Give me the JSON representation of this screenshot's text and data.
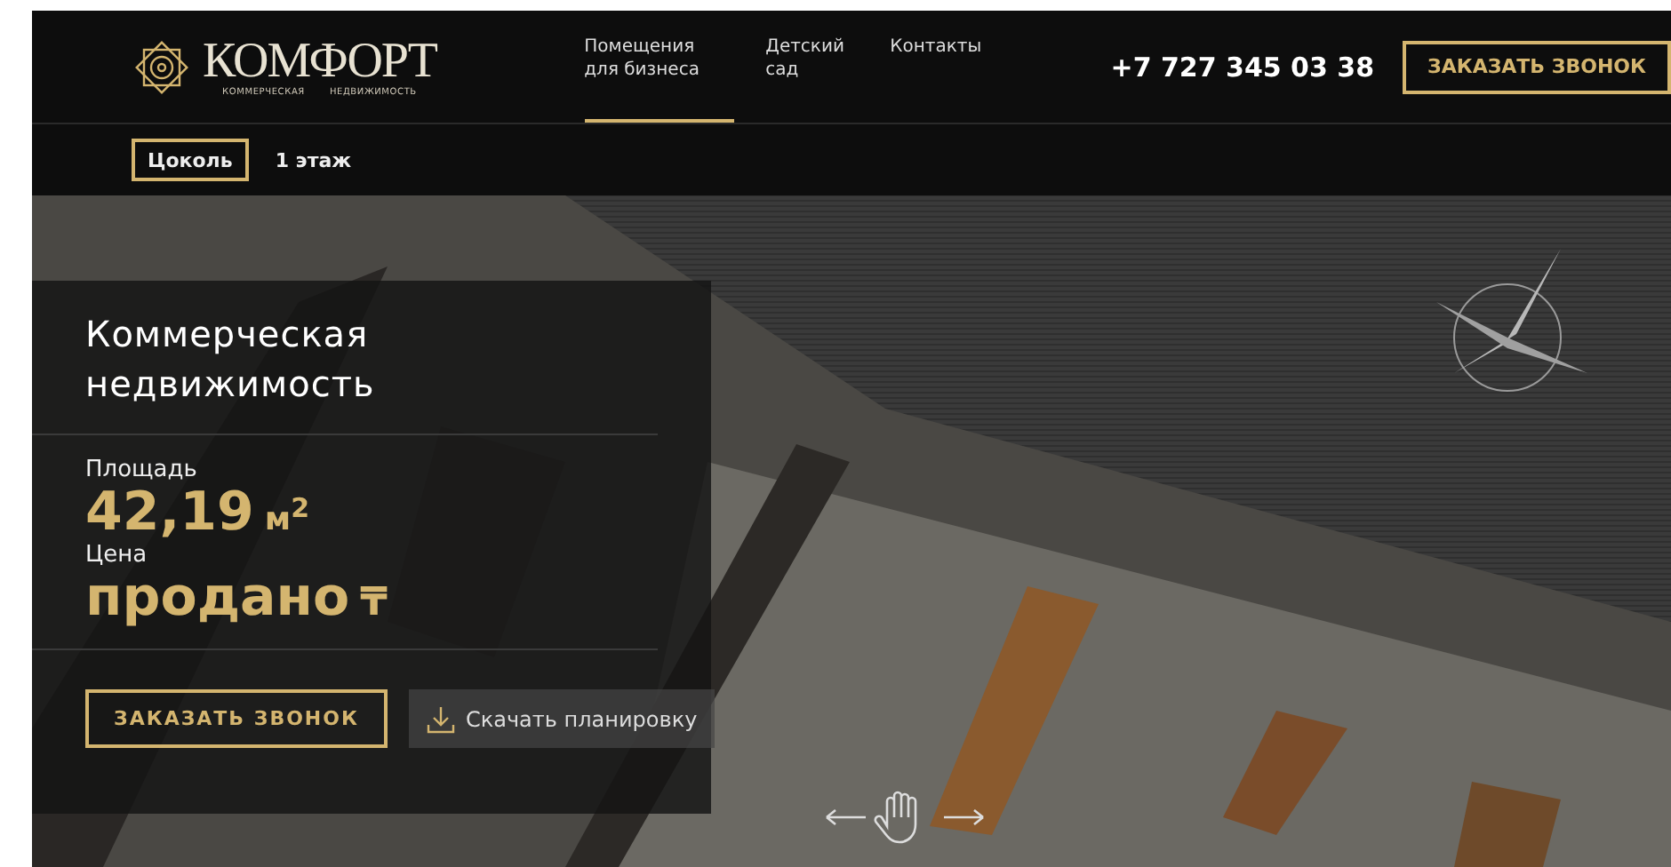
{
  "header": {
    "logo": {
      "name": "КОМФОРТ",
      "subtitle_left": "КОММЕРЧЕСКАЯ",
      "subtitle_right": "НЕДВИЖИМОСТЬ"
    },
    "nav": [
      {
        "label": "Помещения для бизнеса",
        "selected": true
      },
      {
        "label": "Детский сад",
        "selected": false
      },
      {
        "label": "Контакты",
        "selected": false
      }
    ],
    "phone": "+7 727 345 03 38",
    "callback_button": "ЗАКАЗАТЬ ЗВОНОК"
  },
  "floors": [
    {
      "label": "Цоколь",
      "selected": true
    },
    {
      "label": "1 этаж",
      "selected": false
    }
  ],
  "card": {
    "title": "Коммерческая недвижимость",
    "area_label": "Площадь",
    "area_value": "42,19",
    "area_unit": "м$^{2}$",
    "price_label": "Цена",
    "price_value": "продано",
    "currency": "₸",
    "callback_button": "ЗАКАЗАТЬ ЗВОНОК",
    "download_button": "Скачать планировку"
  }
}
